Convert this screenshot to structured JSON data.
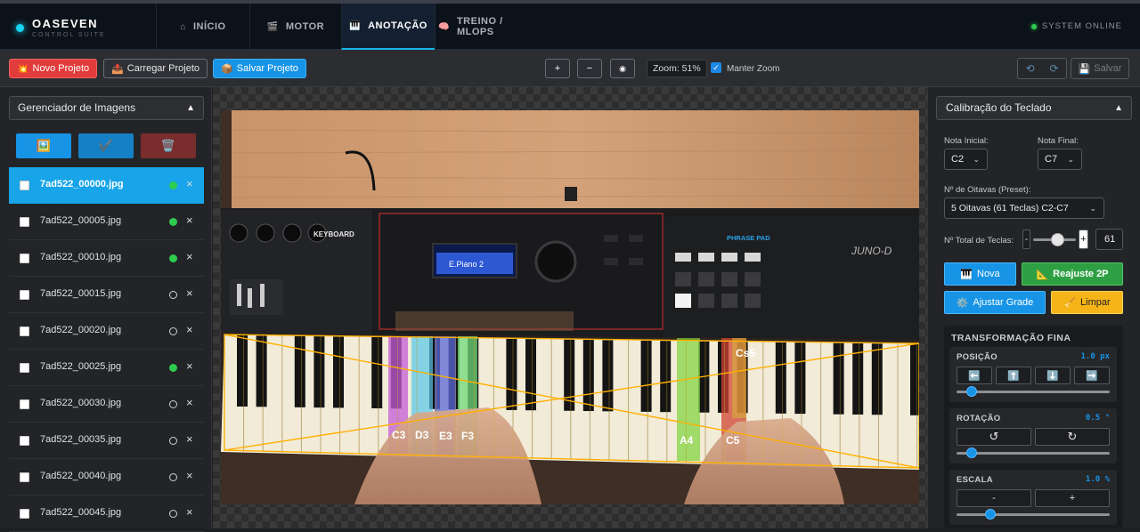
{
  "brand": {
    "name": "OASEVEN",
    "subtitle": "CONTROL SUITE"
  },
  "nav": {
    "tabs": [
      {
        "label": "INÍCIO",
        "icon": "home-icon",
        "glyph": "⌂"
      },
      {
        "label": "MOTOR",
        "icon": "film-icon",
        "glyph": "🎬"
      },
      {
        "label": "ANOTAÇÃO",
        "icon": "piano-icon",
        "glyph": "🎹"
      },
      {
        "label": "TREINO / MLOPS",
        "icon": "brain-icon",
        "glyph": "🧠"
      }
    ],
    "active": "ANOTAÇÃO",
    "status": "SYSTEM ONLINE"
  },
  "toolbar": {
    "new_project": "Novo Projeto",
    "load_project": "Carregar Projeto",
    "save_project": "Salvar Projeto",
    "zoom_in": "+",
    "zoom_out": "−",
    "zoom_fit": "◉",
    "zoom_label": "Zoom: 51%",
    "keep_zoom": "Manter Zoom",
    "keep_zoom_checked": true,
    "save": "Salvar"
  },
  "image_manager": {
    "title": "Gerenciador de Imagens",
    "files": [
      {
        "name": "7ad522_00000.jpg",
        "status": "done",
        "selected": true
      },
      {
        "name": "7ad522_00005.jpg",
        "status": "done"
      },
      {
        "name": "7ad522_00010.jpg",
        "status": "done"
      },
      {
        "name": "7ad522_00015.jpg",
        "status": "pending"
      },
      {
        "name": "7ad522_00020.jpg",
        "status": "pending"
      },
      {
        "name": "7ad522_00025.jpg",
        "status": "done"
      },
      {
        "name": "7ad522_00030.jpg",
        "status": "pending"
      },
      {
        "name": "7ad522_00035.jpg",
        "status": "pending"
      },
      {
        "name": "7ad522_00040.jpg",
        "status": "pending"
      },
      {
        "name": "7ad522_00045.jpg",
        "status": "pending"
      }
    ]
  },
  "canvas": {
    "screen_label": "E.Piano 2",
    "brand_label": "JUNO-D",
    "keyboard_label": "KEYBOARD",
    "phrase_pad": "PHRASE PAD",
    "note_labels": [
      "C3",
      "D3",
      "E3",
      "F3",
      "A4",
      "C5",
      "Cs5"
    ]
  },
  "calibration": {
    "title": "Calibração do Teclado",
    "start_note_label": "Nota Inicial:",
    "start_note": "C2",
    "end_note_label": "Nota Final:",
    "end_note": "C7",
    "octaves_label": "Nº de Oitavas (Preset):",
    "octaves_value": "5 Oitavas (61 Teclas) C2-C7",
    "total_keys_label": "Nº Total de Teclas:",
    "total_keys": "61",
    "minus": "-",
    "plus": "+",
    "new_btn": "Nova",
    "adjust2p_btn": "Reajuste 2P",
    "grid_btn": "Ajustar Grade",
    "clear_btn": "Limpar",
    "transform": {
      "title": "TRANSFORMAÇÃO FINA",
      "position": {
        "label": "POSIÇÃO",
        "value": "1.0 px",
        "level": 0.07
      },
      "rotation": {
        "label": "ROTAÇÃO",
        "value": "0.5 °",
        "level": 0.07
      },
      "scale": {
        "label": "ESCALA",
        "value": "1.0 %",
        "level": 0.2,
        "minus": "-",
        "plus": "+"
      }
    }
  },
  "colors": {
    "accent": "#18a4e8",
    "red": "#e23b3b",
    "green": "#2ecc4f",
    "yellow": "#f5b418"
  }
}
